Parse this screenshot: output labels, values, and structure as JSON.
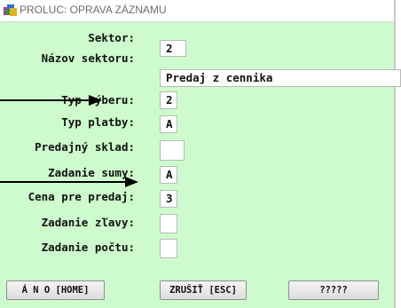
{
  "window": {
    "title": "PROLUC: OPRAVA ZÁZNAMU"
  },
  "form": {
    "fields": [
      {
        "label": "Sektor:",
        "value": "2"
      },
      {
        "label": "Názov sektoru:",
        "value": "Predaj z cennika"
      },
      {
        "label": "Typ výberu:",
        "value": "2"
      },
      {
        "label": "Typ platby:",
        "value": "A"
      },
      {
        "label": "Predajný sklad:",
        "value": ""
      },
      {
        "label": "Zadanie sumy:",
        "value": "A"
      },
      {
        "label": "Cena pre predaj:",
        "value": "3"
      },
      {
        "label": "Zadanie zľavy:",
        "value": ""
      },
      {
        "label": "Zadanie počtu:",
        "value": ""
      }
    ]
  },
  "buttons": {
    "yes": "Á N O [HOME]",
    "cancel": "ZRUŠIŤ [ESC]",
    "extra": "?????"
  }
}
